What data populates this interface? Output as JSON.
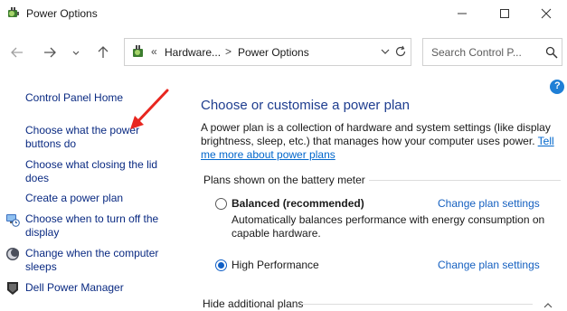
{
  "window": {
    "title": "Power Options"
  },
  "nav": {
    "breadcrumb_overflow": "«",
    "breadcrumb": [
      "Hardware...",
      "Power Options"
    ],
    "separator": ">",
    "search_placeholder": "Search Control P..."
  },
  "left_pane": {
    "home": "Control Panel Home",
    "links": [
      {
        "line1": "Choose what the power",
        "line2": "buttons do"
      },
      {
        "line1": "Choose what closing the lid",
        "line2": "does"
      },
      {
        "line1": "Create a power plan",
        "line2": ""
      },
      {
        "line1": "Choose when to turn off the",
        "line2": "display",
        "icon": "monitor-clock-icon"
      },
      {
        "line1": "Change when the computer",
        "line2": "sleeps",
        "icon": "moon-sleep-icon"
      },
      {
        "line1": "Dell Power Manager",
        "line2": "",
        "icon": "dell-shield-icon"
      }
    ]
  },
  "main": {
    "title": "Choose or customise a power plan",
    "description": "A power plan is a collection of hardware and system settings (like display brightness, sleep, etc.) that manages how your computer uses power.",
    "description_link": "Tell me more about power plans",
    "plans_header": "Plans shown on the battery meter",
    "plans": [
      {
        "name": "Balanced (recommended)",
        "selected": false,
        "bold": true,
        "link": "Change plan settings",
        "description": "Automatically balances performance with energy consumption on capable hardware."
      },
      {
        "name": "High Performance",
        "selected": true,
        "bold": false,
        "link": "Change plan settings",
        "description": ""
      }
    ],
    "hide_plans": "Hide additional plans"
  },
  "colors": {
    "link": "#0a2a82",
    "title": "#1e3d8f",
    "annotation_arrow": "#e8261f"
  }
}
